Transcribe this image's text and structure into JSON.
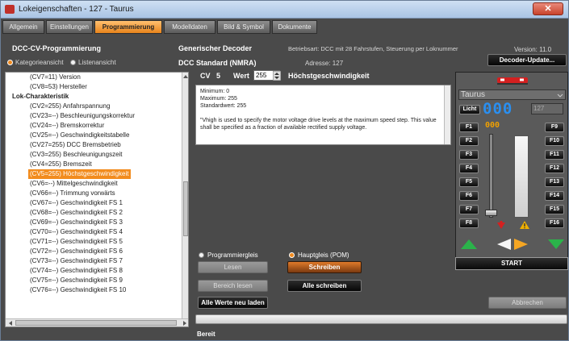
{
  "window": {
    "title": "Lokeigenschaften - 127 - Taurus",
    "close_glyph": "✕"
  },
  "tabs": [
    "Allgemein",
    "Einstellungen",
    "Programmierung",
    "Modelldaten",
    "Bild & Symbol",
    "Dokumente"
  ],
  "active_tab": 2,
  "left": {
    "title": "DCC-CV-Programmierung",
    "view_options": [
      "Kategorieansicht",
      "Listenansicht"
    ],
    "selected_view": 0,
    "tree": [
      {
        "label": "(CV7=11) Version",
        "kind": "item"
      },
      {
        "label": "(CV8=53) Hersteller",
        "kind": "item"
      },
      {
        "label": "Lok-Charakteristik",
        "kind": "group"
      },
      {
        "label": "(CV2=255) Anfahrspannung",
        "kind": "item"
      },
      {
        "label": "(CV23=--) Beschleunigungskorrektur",
        "kind": "item"
      },
      {
        "label": "(CV24=--) Bremskorrektur",
        "kind": "item"
      },
      {
        "label": "(CV25=--) Geschwindigkeitstabelle",
        "kind": "item"
      },
      {
        "label": "(CV27=255) DCC Bremsbetrieb",
        "kind": "item"
      },
      {
        "label": "(CV3=255) Beschleunigungszeit",
        "kind": "item"
      },
      {
        "label": "(CV4=255) Bremszeit",
        "kind": "item"
      },
      {
        "label": "(CV5=255) Höchstgeschwindigkeit",
        "kind": "selected"
      },
      {
        "label": "(CV6=--) Mittelgeschwindigkeit",
        "kind": "item"
      },
      {
        "label": "(CV66=--) Trimmung vorwärts",
        "kind": "item"
      },
      {
        "label": "(CV67=--) Geschwindigkeit FS 1",
        "kind": "item"
      },
      {
        "label": "(CV68=--) Geschwindigkeit FS 2",
        "kind": "item"
      },
      {
        "label": "(CV69=--) Geschwindigkeit FS 3",
        "kind": "item"
      },
      {
        "label": "(CV70=--) Geschwindigkeit FS 4",
        "kind": "item"
      },
      {
        "label": "(CV71=--) Geschwindigkeit FS 5",
        "kind": "item"
      },
      {
        "label": "(CV72=--) Geschwindigkeit FS 6",
        "kind": "item"
      },
      {
        "label": "(CV73=--) Geschwindigkeit FS 7",
        "kind": "item"
      },
      {
        "label": "(CV74=--) Geschwindigkeit FS 8",
        "kind": "item"
      },
      {
        "label": "(CV75=--) Geschwindigkeit FS 9",
        "kind": "item"
      },
      {
        "label": "(CV76=--) Geschwindigkeit FS 10",
        "kind": "item"
      }
    ]
  },
  "middle": {
    "decoder_label": "Generischer Decoder",
    "decoder_type": "DCC Standard (NMRA)",
    "betriebsart": "Betriebsart: DCC mit 28 Fahrstufen, Steuerung per Loknummer",
    "address": "Adresse: 127",
    "cv_label": "CV",
    "cv_number": "5",
    "wert_label": "Wert",
    "wert_value": "255",
    "cv_name": "Höchstgeschwindigkeit",
    "description": [
      "Minimum: 0",
      "Maximum: 255",
      "Standardwert: 255",
      "",
      "\"Vhigh is used to specify the motor voltage drive levels at the maximum speed step. This value shall be specified as a fraction of available rectified supply voltage."
    ],
    "mode_options": [
      "Programmiergleis",
      "Hauptgleis (POM)"
    ],
    "selected_mode": 1,
    "buttons": {
      "lesen": "Lesen",
      "schreiben": "Schreiben",
      "bereich_lesen": "Bereich lesen",
      "alle_schreiben": "Alle schreiben",
      "alle_neu_laden": "Alle Werte neu laden",
      "abbrechen": "Abbrechen"
    },
    "status": "Bereit"
  },
  "right": {
    "version": "Version: 11.0",
    "update_button": "Decoder-Update...",
    "loco_name": "Taurus",
    "licht": "Licht",
    "speed_display": "000",
    "step_value": "127",
    "function_digits": "000",
    "functions_left": [
      "F1",
      "F2",
      "F3",
      "F4",
      "F5",
      "F6",
      "F7",
      "F8"
    ],
    "functions_right": [
      "F9",
      "F10",
      "F11",
      "F12",
      "F13",
      "F14",
      "F15",
      "F16"
    ],
    "start_button": "START",
    "colors": {
      "forward": "#2bb34a",
      "direction_left": "#f5f5f5",
      "direction_right": "#f5a623",
      "stop": "#d42020",
      "warning": "#f0b000"
    }
  }
}
